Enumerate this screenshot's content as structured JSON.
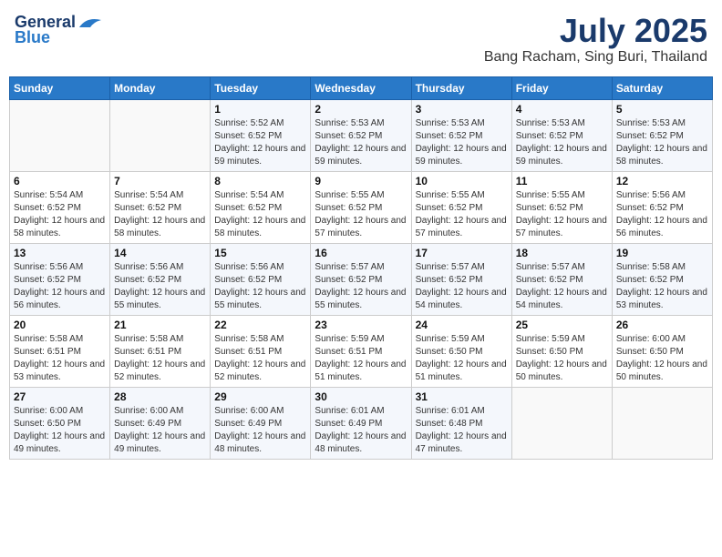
{
  "header": {
    "logo_line1": "General",
    "logo_line2": "Blue",
    "month_title": "July 2025",
    "location": "Bang Racham, Sing Buri, Thailand"
  },
  "days_of_week": [
    "Sunday",
    "Monday",
    "Tuesday",
    "Wednesday",
    "Thursday",
    "Friday",
    "Saturday"
  ],
  "weeks": [
    [
      {
        "day": "",
        "sunrise": "",
        "sunset": "",
        "daylight": ""
      },
      {
        "day": "",
        "sunrise": "",
        "sunset": "",
        "daylight": ""
      },
      {
        "day": "1",
        "sunrise": "Sunrise: 5:52 AM",
        "sunset": "Sunset: 6:52 PM",
        "daylight": "Daylight: 12 hours and 59 minutes."
      },
      {
        "day": "2",
        "sunrise": "Sunrise: 5:53 AM",
        "sunset": "Sunset: 6:52 PM",
        "daylight": "Daylight: 12 hours and 59 minutes."
      },
      {
        "day": "3",
        "sunrise": "Sunrise: 5:53 AM",
        "sunset": "Sunset: 6:52 PM",
        "daylight": "Daylight: 12 hours and 59 minutes."
      },
      {
        "day": "4",
        "sunrise": "Sunrise: 5:53 AM",
        "sunset": "Sunset: 6:52 PM",
        "daylight": "Daylight: 12 hours and 59 minutes."
      },
      {
        "day": "5",
        "sunrise": "Sunrise: 5:53 AM",
        "sunset": "Sunset: 6:52 PM",
        "daylight": "Daylight: 12 hours and 58 minutes."
      }
    ],
    [
      {
        "day": "6",
        "sunrise": "Sunrise: 5:54 AM",
        "sunset": "Sunset: 6:52 PM",
        "daylight": "Daylight: 12 hours and 58 minutes."
      },
      {
        "day": "7",
        "sunrise": "Sunrise: 5:54 AM",
        "sunset": "Sunset: 6:52 PM",
        "daylight": "Daylight: 12 hours and 58 minutes."
      },
      {
        "day": "8",
        "sunrise": "Sunrise: 5:54 AM",
        "sunset": "Sunset: 6:52 PM",
        "daylight": "Daylight: 12 hours and 58 minutes."
      },
      {
        "day": "9",
        "sunrise": "Sunrise: 5:55 AM",
        "sunset": "Sunset: 6:52 PM",
        "daylight": "Daylight: 12 hours and 57 minutes."
      },
      {
        "day": "10",
        "sunrise": "Sunrise: 5:55 AM",
        "sunset": "Sunset: 6:52 PM",
        "daylight": "Daylight: 12 hours and 57 minutes."
      },
      {
        "day": "11",
        "sunrise": "Sunrise: 5:55 AM",
        "sunset": "Sunset: 6:52 PM",
        "daylight": "Daylight: 12 hours and 57 minutes."
      },
      {
        "day": "12",
        "sunrise": "Sunrise: 5:56 AM",
        "sunset": "Sunset: 6:52 PM",
        "daylight": "Daylight: 12 hours and 56 minutes."
      }
    ],
    [
      {
        "day": "13",
        "sunrise": "Sunrise: 5:56 AM",
        "sunset": "Sunset: 6:52 PM",
        "daylight": "Daylight: 12 hours and 56 minutes."
      },
      {
        "day": "14",
        "sunrise": "Sunrise: 5:56 AM",
        "sunset": "Sunset: 6:52 PM",
        "daylight": "Daylight: 12 hours and 55 minutes."
      },
      {
        "day": "15",
        "sunrise": "Sunrise: 5:56 AM",
        "sunset": "Sunset: 6:52 PM",
        "daylight": "Daylight: 12 hours and 55 minutes."
      },
      {
        "day": "16",
        "sunrise": "Sunrise: 5:57 AM",
        "sunset": "Sunset: 6:52 PM",
        "daylight": "Daylight: 12 hours and 55 minutes."
      },
      {
        "day": "17",
        "sunrise": "Sunrise: 5:57 AM",
        "sunset": "Sunset: 6:52 PM",
        "daylight": "Daylight: 12 hours and 54 minutes."
      },
      {
        "day": "18",
        "sunrise": "Sunrise: 5:57 AM",
        "sunset": "Sunset: 6:52 PM",
        "daylight": "Daylight: 12 hours and 54 minutes."
      },
      {
        "day": "19",
        "sunrise": "Sunrise: 5:58 AM",
        "sunset": "Sunset: 6:52 PM",
        "daylight": "Daylight: 12 hours and 53 minutes."
      }
    ],
    [
      {
        "day": "20",
        "sunrise": "Sunrise: 5:58 AM",
        "sunset": "Sunset: 6:51 PM",
        "daylight": "Daylight: 12 hours and 53 minutes."
      },
      {
        "day": "21",
        "sunrise": "Sunrise: 5:58 AM",
        "sunset": "Sunset: 6:51 PM",
        "daylight": "Daylight: 12 hours and 52 minutes."
      },
      {
        "day": "22",
        "sunrise": "Sunrise: 5:58 AM",
        "sunset": "Sunset: 6:51 PM",
        "daylight": "Daylight: 12 hours and 52 minutes."
      },
      {
        "day": "23",
        "sunrise": "Sunrise: 5:59 AM",
        "sunset": "Sunset: 6:51 PM",
        "daylight": "Daylight: 12 hours and 51 minutes."
      },
      {
        "day": "24",
        "sunrise": "Sunrise: 5:59 AM",
        "sunset": "Sunset: 6:50 PM",
        "daylight": "Daylight: 12 hours and 51 minutes."
      },
      {
        "day": "25",
        "sunrise": "Sunrise: 5:59 AM",
        "sunset": "Sunset: 6:50 PM",
        "daylight": "Daylight: 12 hours and 50 minutes."
      },
      {
        "day": "26",
        "sunrise": "Sunrise: 6:00 AM",
        "sunset": "Sunset: 6:50 PM",
        "daylight": "Daylight: 12 hours and 50 minutes."
      }
    ],
    [
      {
        "day": "27",
        "sunrise": "Sunrise: 6:00 AM",
        "sunset": "Sunset: 6:50 PM",
        "daylight": "Daylight: 12 hours and 49 minutes."
      },
      {
        "day": "28",
        "sunrise": "Sunrise: 6:00 AM",
        "sunset": "Sunset: 6:49 PM",
        "daylight": "Daylight: 12 hours and 49 minutes."
      },
      {
        "day": "29",
        "sunrise": "Sunrise: 6:00 AM",
        "sunset": "Sunset: 6:49 PM",
        "daylight": "Daylight: 12 hours and 48 minutes."
      },
      {
        "day": "30",
        "sunrise": "Sunrise: 6:01 AM",
        "sunset": "Sunset: 6:49 PM",
        "daylight": "Daylight: 12 hours and 48 minutes."
      },
      {
        "day": "31",
        "sunrise": "Sunrise: 6:01 AM",
        "sunset": "Sunset: 6:48 PM",
        "daylight": "Daylight: 12 hours and 47 minutes."
      },
      {
        "day": "",
        "sunrise": "",
        "sunset": "",
        "daylight": ""
      },
      {
        "day": "",
        "sunrise": "",
        "sunset": "",
        "daylight": ""
      }
    ]
  ]
}
